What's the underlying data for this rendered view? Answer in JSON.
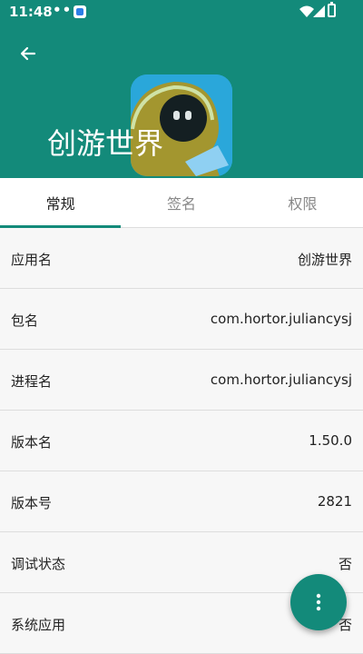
{
  "status_bar": {
    "time": "11:48",
    "dots": "•••"
  },
  "header": {
    "app_name": "创游世界"
  },
  "tabs": [
    {
      "label": "常规",
      "active": true
    },
    {
      "label": "签名",
      "active": false
    },
    {
      "label": "权限",
      "active": false
    }
  ],
  "rows": [
    {
      "label": "应用名",
      "value": "创游世界"
    },
    {
      "label": "包名",
      "value": "com.hortor.juliancysj"
    },
    {
      "label": "进程名",
      "value": "com.hortor.juliancysj"
    },
    {
      "label": "版本名",
      "value": "1.50.0"
    },
    {
      "label": "版本号",
      "value": "2821"
    },
    {
      "label": "调试状态",
      "value": "否"
    },
    {
      "label": "系统应用",
      "value": "否"
    }
  ],
  "colors": {
    "primary": "#138a7a",
    "background": "#f7f7f7"
  },
  "icons": {
    "back": "arrow-left-icon",
    "fab": "more-vertical-icon"
  }
}
